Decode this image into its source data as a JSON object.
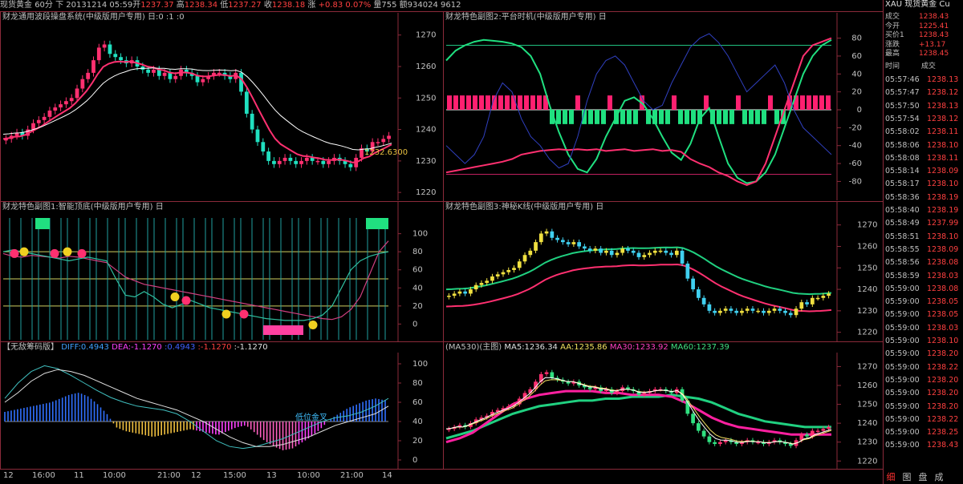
{
  "header": {
    "name": "现货黄金",
    "period": "60分",
    "arrow": "下",
    "date_time": "20131214 05:59",
    "open_label": "开",
    "open": "1237.37",
    "high_label": "高",
    "high": "1238.34",
    "low_label": "低",
    "low": "1237.27",
    "close_label": "收",
    "close": "1238.18",
    "change_label": "涨",
    "change": "+0.83",
    "change_pct": "0.07%",
    "volume_label": "量",
    "volume": "755",
    "amount_label": "额",
    "amount": "934024",
    "extra": "9612"
  },
  "panels": {
    "p1": {
      "title": "财龙通用波段操盘系统(中级版用户专用)",
      "suffix": "日:0 :1 :0",
      "annotation": "1232.6300"
    },
    "p2": {
      "title": "财龙特色副图2:平台时机(中级版用户专用)",
      "suffix": "日"
    },
    "p3": {
      "title": "财龙特色副图1:智能顶底(中级版用户专用)",
      "suffix": "日"
    },
    "p4": {
      "title": "财龙特色副图3:神秘K线(中级版用户专用)",
      "suffix": "日"
    },
    "p5": {
      "title": "【无敌筹码版】",
      "diff": "DIFF:0.4943",
      "dea": "DEA:-1.1270",
      "v1": ":0.4943",
      "v2": ":-1.1270",
      "v3": ":-1.1270",
      "annotation": "低位金叉"
    },
    "p6": {
      "title": "(MA530)(主图)",
      "ma5": "MA5:1236.34",
      "aa": "AA:1235.86",
      "ma30": "MA30:1233.92",
      "ma60": "MA60:1237.39"
    }
  },
  "axes": {
    "price_ticks": [
      "1270",
      "1260",
      "1250",
      "1240",
      "1230",
      "1220"
    ],
    "osc_ticks": [
      "80",
      "60",
      "40",
      "20",
      "0",
      "-20",
      "-40",
      "-60",
      "-80"
    ],
    "pct_ticks": [
      "100",
      "80",
      "60",
      "40",
      "20",
      "0"
    ],
    "x_labels": [
      "12",
      "16:00",
      "11",
      "10:00",
      "21:00",
      "12",
      "15:00",
      "13",
      "10:00",
      "21:00",
      "14"
    ]
  },
  "quote": {
    "symbol": "XAU",
    "name": "现货黄金",
    "tag": "Cu",
    "rows": [
      {
        "k": "成交",
        "v": "1238.43"
      },
      {
        "k": "今开",
        "v": "1225.41"
      },
      {
        "k": "买价1",
        "v": "1238.43"
      },
      {
        "k": "涨跌",
        "v": "+13.17"
      },
      {
        "k": "最高",
        "v": "1238.45"
      }
    ],
    "col_time": "时间",
    "col_price": "成交",
    "trades": [
      {
        "t": "05:57:46",
        "p": "1238.13"
      },
      {
        "t": "05:57:47",
        "p": "1238.12"
      },
      {
        "t": "05:57:50",
        "p": "1238.13"
      },
      {
        "t": "05:57:54",
        "p": "1238.12"
      },
      {
        "t": "05:58:02",
        "p": "1238.11"
      },
      {
        "t": "05:58:06",
        "p": "1238.10"
      },
      {
        "t": "05:58:08",
        "p": "1238.11"
      },
      {
        "t": "05:58:14",
        "p": "1238.09"
      },
      {
        "t": "05:58:17",
        "p": "1238.10"
      },
      {
        "t": "05:58:36",
        "p": "1238.19"
      },
      {
        "t": "05:58:40",
        "p": "1238.19"
      },
      {
        "t": "05:58:49",
        "p": "1237.99"
      },
      {
        "t": "05:58:51",
        "p": "1238.10"
      },
      {
        "t": "05:58:55",
        "p": "1238.09"
      },
      {
        "t": "05:58:56",
        "p": "1238.08"
      },
      {
        "t": "05:58:59",
        "p": "1238.03"
      },
      {
        "t": "05:59:00",
        "p": "1238.08"
      },
      {
        "t": "05:59:00",
        "p": "1238.05"
      },
      {
        "t": "05:59:00",
        "p": "1238.05"
      },
      {
        "t": "05:59:00",
        "p": "1238.03"
      },
      {
        "t": "05:59:00",
        "p": "1238.10"
      },
      {
        "t": "05:59:00",
        "p": "1238.20"
      },
      {
        "t": "05:59:00",
        "p": "1238.22"
      },
      {
        "t": "05:59:00",
        "p": "1238.20"
      },
      {
        "t": "05:59:00",
        "p": "1238.20"
      },
      {
        "t": "05:59:00",
        "p": "1238.20"
      },
      {
        "t": "05:59:00",
        "p": "1238.22"
      },
      {
        "t": "05:59:00",
        "p": "1238.25"
      },
      {
        "t": "05:59:00",
        "p": "1238.43"
      }
    ],
    "tabs": [
      "细",
      "图",
      "盘",
      "成"
    ]
  },
  "chart_data": [
    {
      "type": "candlestick",
      "id": "main",
      "ylim": [
        1218,
        1274
      ],
      "close": [
        1237,
        1238,
        1239,
        1238,
        1240,
        1242,
        1243,
        1244,
        1246,
        1247,
        1248,
        1249,
        1250,
        1253,
        1256,
        1258,
        1262,
        1266,
        1267,
        1264,
        1263,
        1262,
        1261,
        1262,
        1260,
        1259,
        1258,
        1259,
        1257,
        1258,
        1256,
        1257,
        1259,
        1258,
        1257,
        1255,
        1256,
        1257,
        1258,
        1258,
        1257,
        1256,
        1258,
        1252,
        1245,
        1240,
        1236,
        1233,
        1230,
        1229,
        1230,
        1231,
        1230,
        1229,
        1230,
        1231,
        1230,
        1230,
        1229,
        1230,
        1231,
        1230,
        1229,
        1228,
        1231,
        1234,
        1233,
        1236,
        1236,
        1237,
        1238
      ]
    },
    {
      "type": "oscillator",
      "id": "platform",
      "ylim": [
        -85,
        85
      ],
      "series": [
        {
          "color": "#20e080",
          "values": [
            55,
            66,
            72,
            76,
            78,
            77,
            76,
            74,
            70,
            60,
            40,
            5,
            -25,
            -50,
            -66,
            -70,
            -55,
            -30,
            -10,
            10,
            14,
            6,
            -10,
            -30,
            -48,
            -56,
            -38,
            -10,
            2,
            -30,
            -60,
            -76,
            -82,
            -80,
            -70,
            -50,
            -20,
            10,
            40,
            60,
            72,
            78
          ]
        },
        {
          "color": "#ff3070",
          "values": [
            -70,
            -68,
            -66,
            -64,
            -62,
            -60,
            -58,
            -55,
            -50,
            -48,
            -46,
            -45,
            -44,
            -45,
            -44,
            -45,
            -44,
            -46,
            -45,
            -44,
            -46,
            -45,
            -44,
            -46,
            -45,
            -47,
            -55,
            -60,
            -64,
            -70,
            -74,
            -80,
            -84,
            -80,
            -60,
            -30,
            0,
            30,
            60,
            72,
            76,
            80
          ]
        },
        {
          "color": "#3040c0",
          "values": [
            -40,
            -50,
            -60,
            -50,
            -30,
            10,
            30,
            20,
            -10,
            -30,
            -40,
            -55,
            -65,
            -60,
            -30,
            10,
            40,
            55,
            60,
            50,
            30,
            10,
            0,
            5,
            30,
            50,
            70,
            80,
            85,
            75,
            60,
            40,
            20,
            30,
            40,
            50,
            30,
            0,
            -20,
            -30,
            -40,
            -50
          ]
        }
      ]
    },
    {
      "type": "oscillator",
      "id": "topbottom",
      "ylim": [
        -5,
        105
      ],
      "series": [
        {
          "color": "#d04080",
          "values": [
            78,
            75,
            74,
            76,
            75,
            74,
            73,
            75,
            74,
            72,
            70,
            68,
            60,
            52,
            48,
            44,
            42,
            40,
            38,
            36,
            34,
            32,
            30,
            28,
            26,
            24,
            22,
            20,
            18,
            16,
            14,
            12,
            10,
            8,
            6,
            5,
            8,
            16,
            30,
            55,
            80,
            92
          ]
        },
        {
          "color": "#30c0a0",
          "values": [
            80,
            82,
            80,
            78,
            76,
            74,
            72,
            70,
            72,
            74,
            72,
            70,
            50,
            32,
            30,
            36,
            30,
            22,
            18,
            22,
            26,
            22,
            18,
            16,
            14,
            12,
            10,
            8,
            6,
            5,
            4,
            4,
            4,
            6,
            10,
            20,
            40,
            60,
            70,
            75,
            78,
            80
          ]
        }
      ]
    },
    {
      "type": "macd",
      "id": "macd",
      "ylim": [
        -5,
        105
      ],
      "bars": [
        10,
        12,
        14,
        16,
        18,
        20,
        24,
        28,
        30,
        26,
        18,
        8,
        -6,
        -10,
        -12,
        -14,
        -16,
        -14,
        -12,
        -10,
        -8,
        -10,
        -12,
        -14,
        -10,
        -6,
        -4,
        -12,
        -20,
        -26,
        -30,
        -28,
        -22,
        -16,
        -8,
        2,
        8,
        14,
        18,
        22,
        24,
        22
      ]
    },
    {
      "type": "candlestick",
      "id": "ma530",
      "ylim": [
        1218,
        1274
      ],
      "ma60": [
        1232,
        1234,
        1236,
        1239,
        1242,
        1245,
        1247,
        1249,
        1250,
        1251,
        1252,
        1252,
        1253,
        1253,
        1254,
        1254,
        1254,
        1255,
        1254,
        1253,
        1251,
        1248,
        1245,
        1243,
        1241,
        1240,
        1239,
        1238,
        1238,
        1238
      ],
      "ma30": [
        1230,
        1232,
        1235,
        1240,
        1245,
        1250,
        1253,
        1255,
        1256,
        1257,
        1257,
        1257,
        1256,
        1256,
        1255,
        1255,
        1255,
        1254,
        1251,
        1247,
        1243,
        1240,
        1238,
        1237,
        1236,
        1235,
        1234,
        1234,
        1234,
        1234
      ]
    }
  ]
}
